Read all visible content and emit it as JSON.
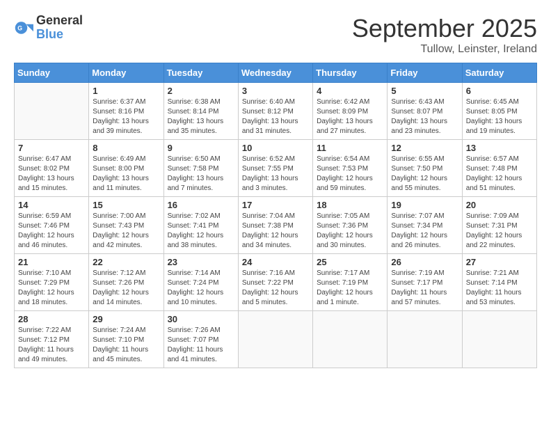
{
  "header": {
    "logo_general": "General",
    "logo_blue": "Blue",
    "month_title": "September 2025",
    "location": "Tullow, Leinster, Ireland"
  },
  "days_of_week": [
    "Sunday",
    "Monday",
    "Tuesday",
    "Wednesday",
    "Thursday",
    "Friday",
    "Saturday"
  ],
  "weeks": [
    [
      {
        "day": "",
        "info": ""
      },
      {
        "day": "1",
        "info": "Sunrise: 6:37 AM\nSunset: 8:16 PM\nDaylight: 13 hours\nand 39 minutes."
      },
      {
        "day": "2",
        "info": "Sunrise: 6:38 AM\nSunset: 8:14 PM\nDaylight: 13 hours\nand 35 minutes."
      },
      {
        "day": "3",
        "info": "Sunrise: 6:40 AM\nSunset: 8:12 PM\nDaylight: 13 hours\nand 31 minutes."
      },
      {
        "day": "4",
        "info": "Sunrise: 6:42 AM\nSunset: 8:09 PM\nDaylight: 13 hours\nand 27 minutes."
      },
      {
        "day": "5",
        "info": "Sunrise: 6:43 AM\nSunset: 8:07 PM\nDaylight: 13 hours\nand 23 minutes."
      },
      {
        "day": "6",
        "info": "Sunrise: 6:45 AM\nSunset: 8:05 PM\nDaylight: 13 hours\nand 19 minutes."
      }
    ],
    [
      {
        "day": "7",
        "info": "Sunrise: 6:47 AM\nSunset: 8:02 PM\nDaylight: 13 hours\nand 15 minutes."
      },
      {
        "day": "8",
        "info": "Sunrise: 6:49 AM\nSunset: 8:00 PM\nDaylight: 13 hours\nand 11 minutes."
      },
      {
        "day": "9",
        "info": "Sunrise: 6:50 AM\nSunset: 7:58 PM\nDaylight: 13 hours\nand 7 minutes."
      },
      {
        "day": "10",
        "info": "Sunrise: 6:52 AM\nSunset: 7:55 PM\nDaylight: 13 hours\nand 3 minutes."
      },
      {
        "day": "11",
        "info": "Sunrise: 6:54 AM\nSunset: 7:53 PM\nDaylight: 12 hours\nand 59 minutes."
      },
      {
        "day": "12",
        "info": "Sunrise: 6:55 AM\nSunset: 7:50 PM\nDaylight: 12 hours\nand 55 minutes."
      },
      {
        "day": "13",
        "info": "Sunrise: 6:57 AM\nSunset: 7:48 PM\nDaylight: 12 hours\nand 51 minutes."
      }
    ],
    [
      {
        "day": "14",
        "info": "Sunrise: 6:59 AM\nSunset: 7:46 PM\nDaylight: 12 hours\nand 46 minutes."
      },
      {
        "day": "15",
        "info": "Sunrise: 7:00 AM\nSunset: 7:43 PM\nDaylight: 12 hours\nand 42 minutes."
      },
      {
        "day": "16",
        "info": "Sunrise: 7:02 AM\nSunset: 7:41 PM\nDaylight: 12 hours\nand 38 minutes."
      },
      {
        "day": "17",
        "info": "Sunrise: 7:04 AM\nSunset: 7:38 PM\nDaylight: 12 hours\nand 34 minutes."
      },
      {
        "day": "18",
        "info": "Sunrise: 7:05 AM\nSunset: 7:36 PM\nDaylight: 12 hours\nand 30 minutes."
      },
      {
        "day": "19",
        "info": "Sunrise: 7:07 AM\nSunset: 7:34 PM\nDaylight: 12 hours\nand 26 minutes."
      },
      {
        "day": "20",
        "info": "Sunrise: 7:09 AM\nSunset: 7:31 PM\nDaylight: 12 hours\nand 22 minutes."
      }
    ],
    [
      {
        "day": "21",
        "info": "Sunrise: 7:10 AM\nSunset: 7:29 PM\nDaylight: 12 hours\nand 18 minutes."
      },
      {
        "day": "22",
        "info": "Sunrise: 7:12 AM\nSunset: 7:26 PM\nDaylight: 12 hours\nand 14 minutes."
      },
      {
        "day": "23",
        "info": "Sunrise: 7:14 AM\nSunset: 7:24 PM\nDaylight: 12 hours\nand 10 minutes."
      },
      {
        "day": "24",
        "info": "Sunrise: 7:16 AM\nSunset: 7:22 PM\nDaylight: 12 hours\nand 5 minutes."
      },
      {
        "day": "25",
        "info": "Sunrise: 7:17 AM\nSunset: 7:19 PM\nDaylight: 12 hours\nand 1 minute."
      },
      {
        "day": "26",
        "info": "Sunrise: 7:19 AM\nSunset: 7:17 PM\nDaylight: 11 hours\nand 57 minutes."
      },
      {
        "day": "27",
        "info": "Sunrise: 7:21 AM\nSunset: 7:14 PM\nDaylight: 11 hours\nand 53 minutes."
      }
    ],
    [
      {
        "day": "28",
        "info": "Sunrise: 7:22 AM\nSunset: 7:12 PM\nDaylight: 11 hours\nand 49 minutes."
      },
      {
        "day": "29",
        "info": "Sunrise: 7:24 AM\nSunset: 7:10 PM\nDaylight: 11 hours\nand 45 minutes."
      },
      {
        "day": "30",
        "info": "Sunrise: 7:26 AM\nSunset: 7:07 PM\nDaylight: 11 hours\nand 41 minutes."
      },
      {
        "day": "",
        "info": ""
      },
      {
        "day": "",
        "info": ""
      },
      {
        "day": "",
        "info": ""
      },
      {
        "day": "",
        "info": ""
      }
    ]
  ]
}
